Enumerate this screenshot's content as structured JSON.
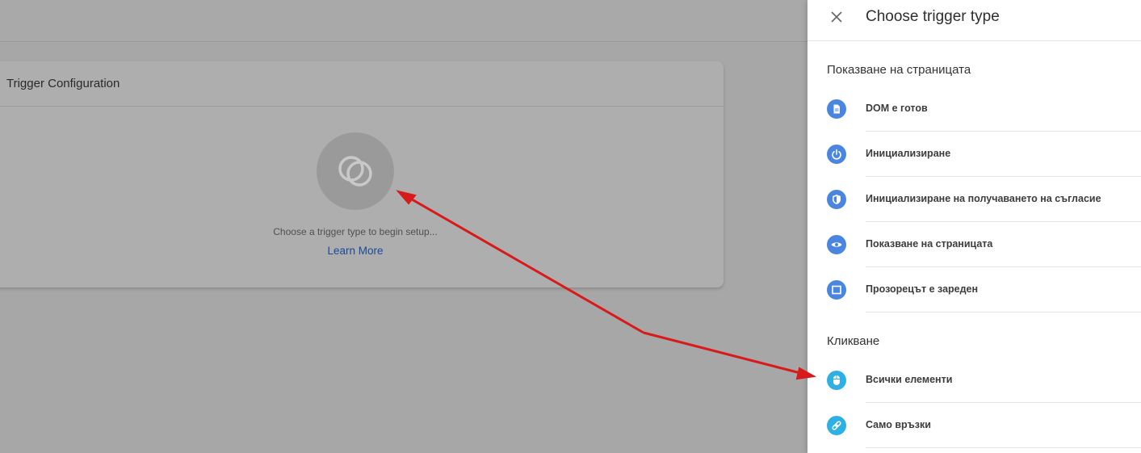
{
  "card": {
    "title": "Trigger Configuration",
    "hint": "Choose a trigger type to begin setup...",
    "learn_more": "Learn More",
    "trigger_icon": "trigger-overlap-circles-icon"
  },
  "panel": {
    "title": "Choose trigger type",
    "close_icon": "close-icon",
    "sections": [
      {
        "title": "Показване на страницата",
        "items": [
          {
            "label": "DOM е готов",
            "icon": "document-icon",
            "color": "#4a86e0"
          },
          {
            "label": "Инициализиране",
            "icon": "power-icon",
            "color": "#4a86e0"
          },
          {
            "label": "Инициализиране на получаването на съгласие",
            "icon": "shield-icon",
            "color": "#4a86e0"
          },
          {
            "label": "Показване на страницата",
            "icon": "eye-icon",
            "color": "#4a86e0"
          },
          {
            "label": "Прозорецът е зареден",
            "icon": "window-icon",
            "color": "#4a86e0"
          }
        ]
      },
      {
        "title": "Кликване",
        "items": [
          {
            "label": "Всички елементи",
            "icon": "mouse-icon",
            "color": "#2eb0e4"
          },
          {
            "label": "Само връзки",
            "icon": "link-icon",
            "color": "#2eb0e4"
          }
        ]
      }
    ]
  },
  "colors": {
    "overlay": "#a7a7a7",
    "arrow": "#d81a1a",
    "link": "#1a4a96",
    "blue_icon": "#4a86e0",
    "cyan_icon": "#2eb0e4"
  }
}
